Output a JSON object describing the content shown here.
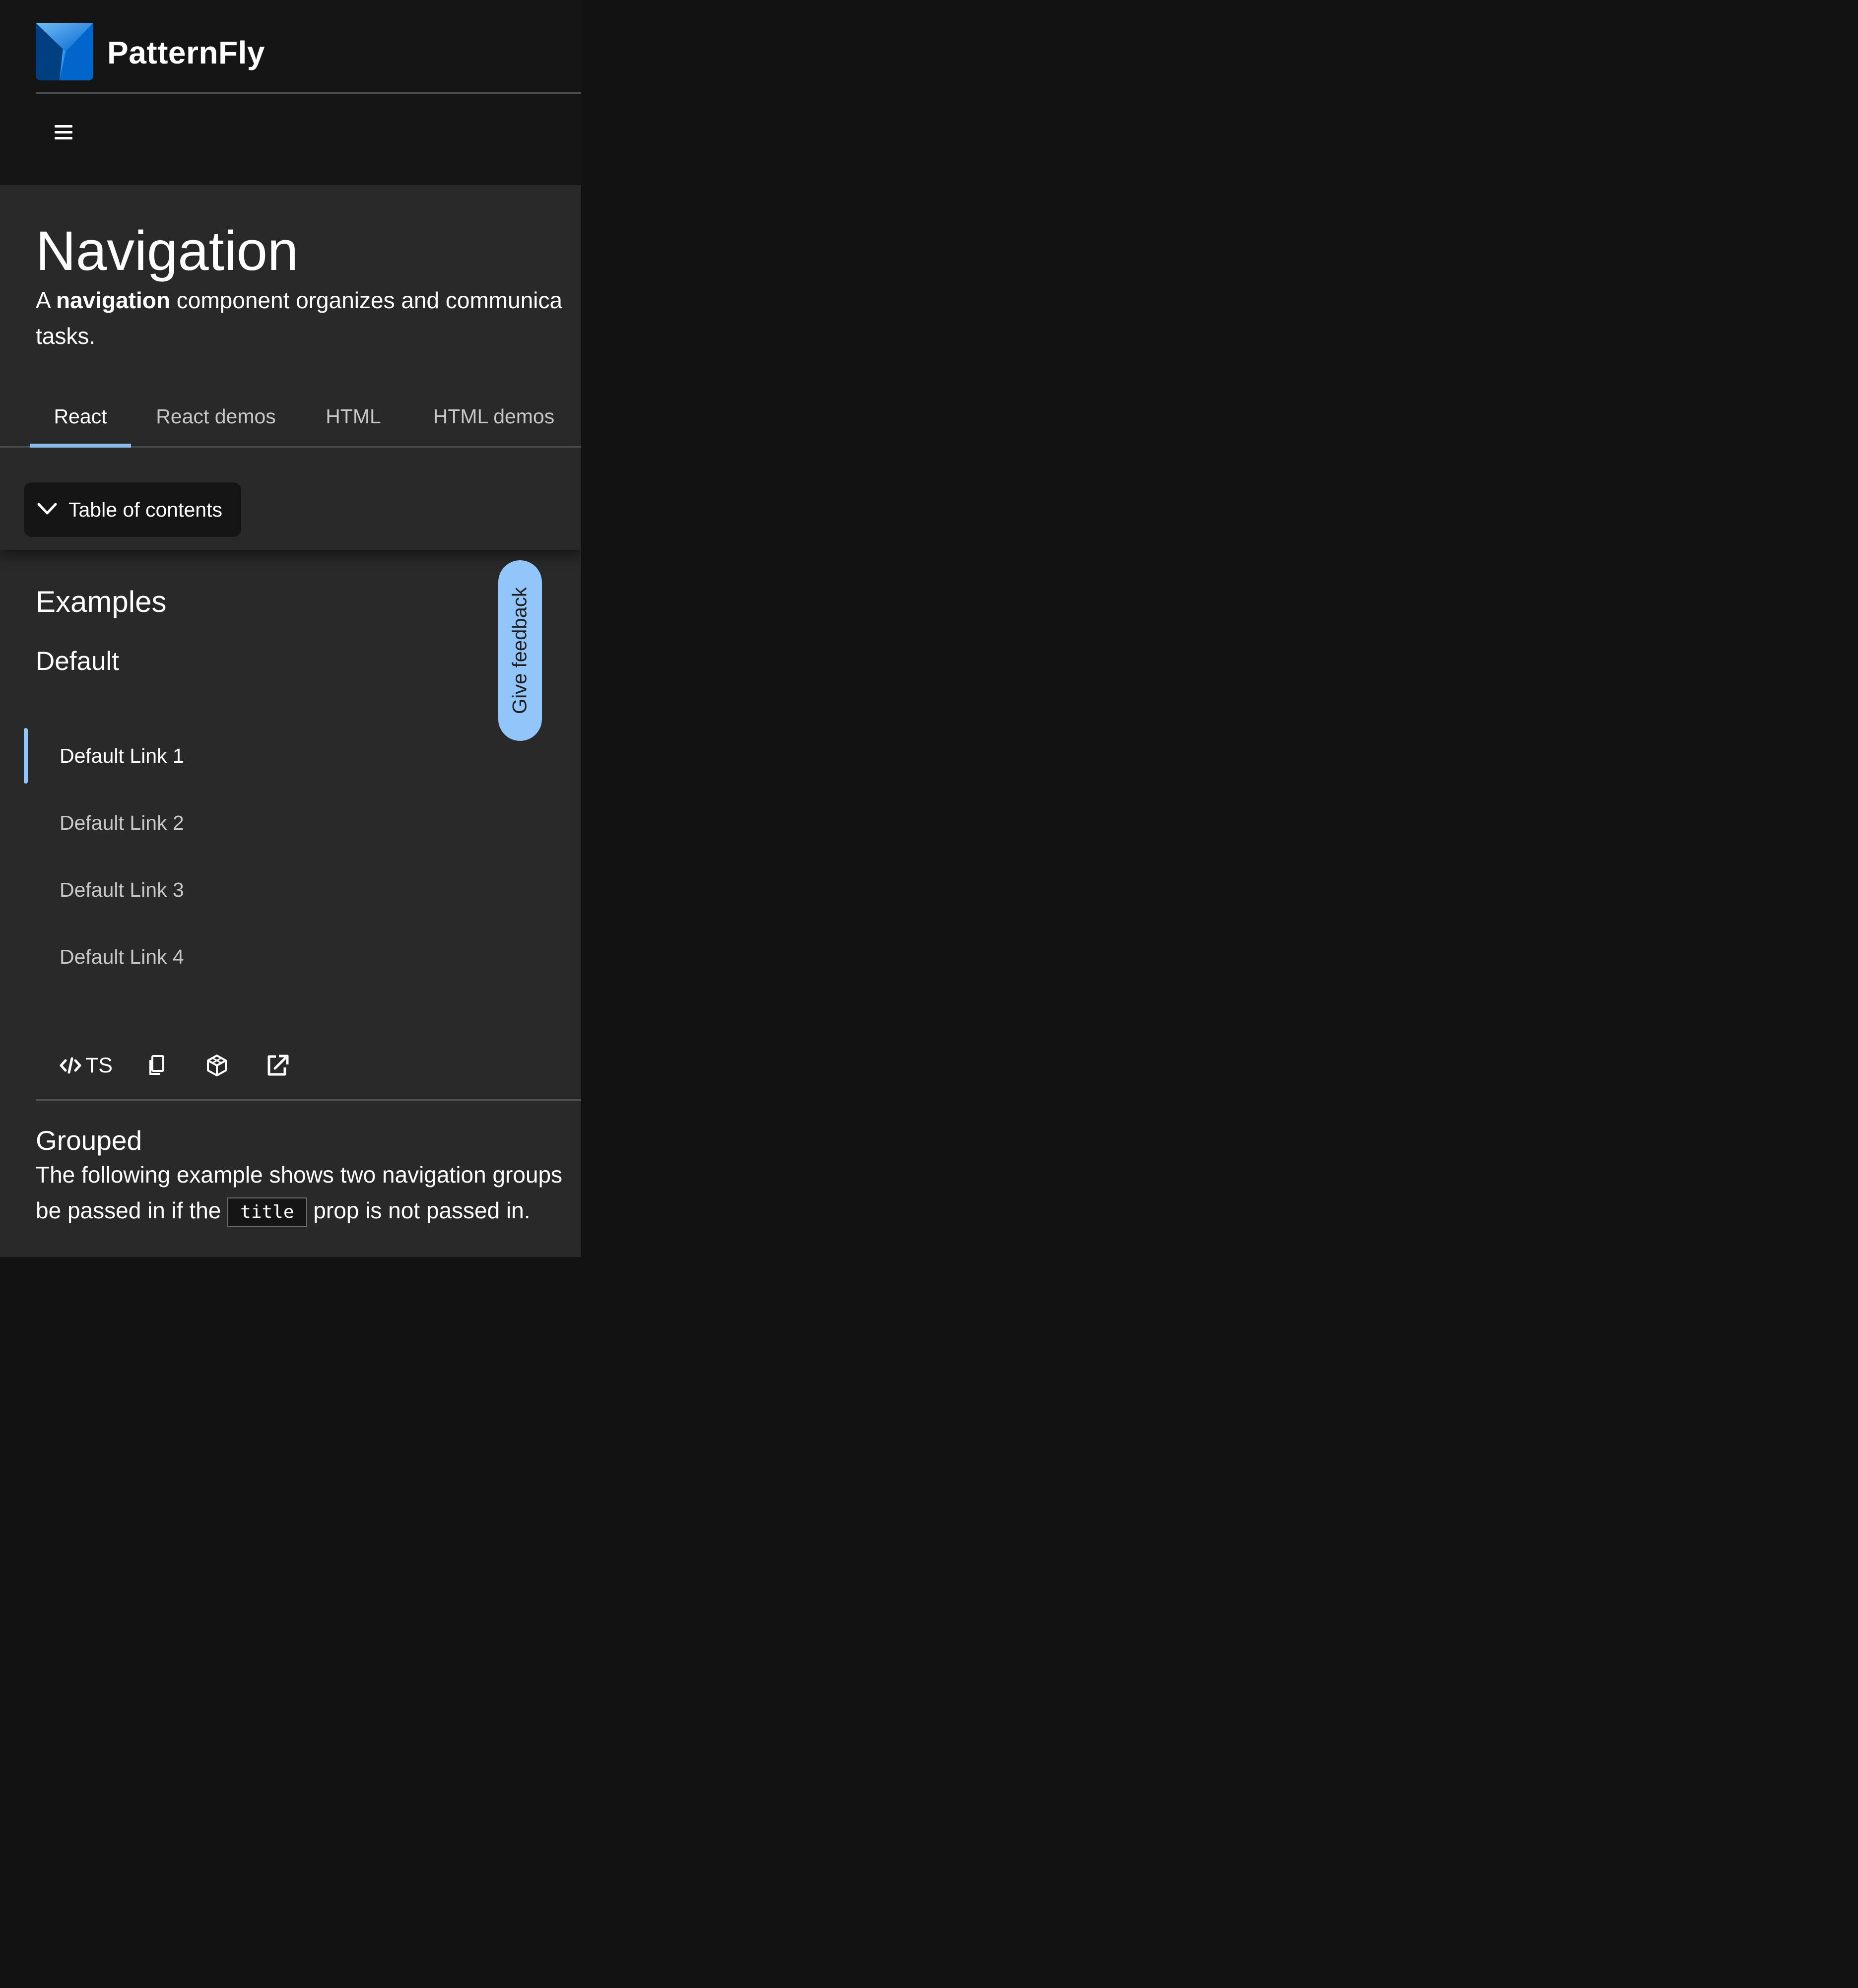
{
  "masthead": {
    "brand": "PatternFly",
    "menu_icon": "hamburger-icon"
  },
  "page": {
    "title": "Navigation",
    "intro_prefix": "A ",
    "intro_bold": "navigation",
    "intro_line1_rest": " component organizes and communica",
    "intro_line2": "tasks."
  },
  "tabs": [
    {
      "label": "React",
      "active": true
    },
    {
      "label": "React demos",
      "active": false
    },
    {
      "label": "HTML",
      "active": false
    },
    {
      "label": "HTML demos",
      "active": false
    }
  ],
  "toc": {
    "label": "Table of contents",
    "icon": "chevron-down-icon"
  },
  "feedback": {
    "label": "Give feedback"
  },
  "examples": {
    "heading": "Examples",
    "default_heading": "Default",
    "nav_items": [
      {
        "label": "Default Link 1",
        "current": true
      },
      {
        "label": "Default Link 2",
        "current": false
      },
      {
        "label": "Default Link 3",
        "current": false
      },
      {
        "label": "Default Link 4",
        "current": false
      }
    ],
    "toolbar": {
      "ts_label": "TS",
      "icons": [
        "code-icon",
        "copy-icon",
        "codesandbox-icon",
        "external-link-icon"
      ]
    }
  },
  "grouped": {
    "heading": "Grouped",
    "line1": "The following example shows two navigation groups",
    "line2_before": "be passed in if the ",
    "line2_code": "title",
    "line2_after": " prop is not passed in."
  },
  "colors": {
    "accent": "#92c5f9",
    "masthead_bg": "#151515",
    "page_bg": "#292929",
    "body_bg": "#121212"
  }
}
